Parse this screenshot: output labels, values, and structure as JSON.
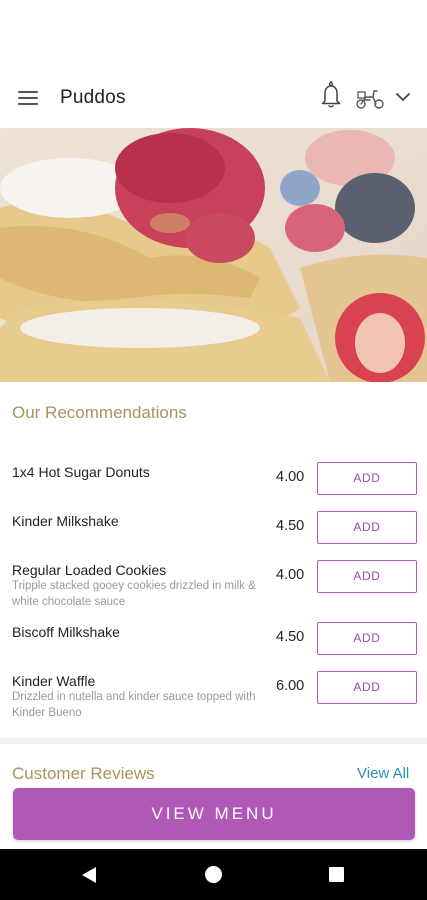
{
  "app_bar": {
    "title": "Puddos",
    "menu_icon": "hamburger-menu-icon",
    "notification_icon": "bell-icon",
    "delivery_icon": "scooter-icon",
    "dropdown_icon": "chevron-down-icon"
  },
  "hero": {
    "image": "waffles-with-berries-and-cream"
  },
  "recommendations": {
    "title": "Our Recommendations",
    "items": [
      {
        "name": "1x4 Hot Sugar Donuts",
        "description": "",
        "price": "4.00",
        "button": "ADD"
      },
      {
        "name": "Kinder Milkshake",
        "description": "",
        "price": "4.50",
        "button": "ADD"
      },
      {
        "name": "Regular Loaded Cookies",
        "description": "Tripple stacked gooey cookies drizzled in milk & white chocolate sauce",
        "price": "4.00",
        "button": "ADD"
      },
      {
        "name": "Biscoff Milkshake",
        "description": "",
        "price": "4.50",
        "button": "ADD"
      },
      {
        "name": "Kinder Waffle",
        "description": "Drizzled in nutella and kinder sauce topped with Kinder Bueno",
        "price": "6.00",
        "button": "ADD"
      }
    ]
  },
  "reviews": {
    "title": "Customer Reviews",
    "view_all": "View All"
  },
  "footer": {
    "view_menu": "VIEW MENU"
  },
  "colors": {
    "accent": "#b058b6",
    "section_title": "#a8925f",
    "link": "#2a8fb8"
  },
  "nav": {
    "back_icon": "back-triangle-icon",
    "home_icon": "home-circle-icon",
    "recents_icon": "recents-square-icon"
  }
}
